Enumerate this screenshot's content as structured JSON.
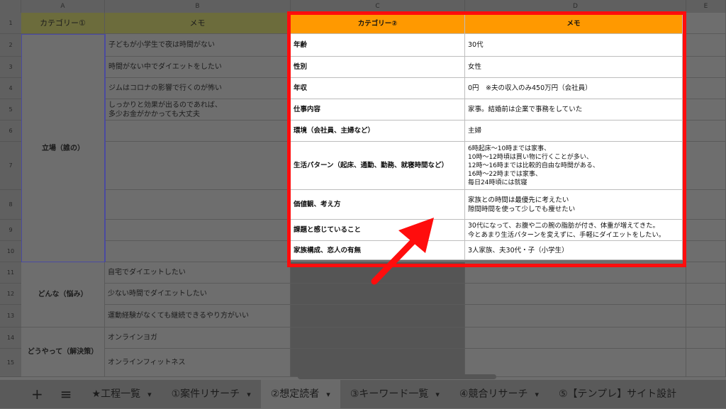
{
  "columns": [
    "A",
    "B",
    "C",
    "D",
    "E"
  ],
  "rows": [
    "1",
    "2",
    "3",
    "4",
    "5",
    "6",
    "7",
    "8",
    "9",
    "10",
    "11",
    "12",
    "13",
    "14",
    "15"
  ],
  "left_header": {
    "category1": "カテゴリー①",
    "memo": "メモ"
  },
  "groups": [
    "立場（誰の）",
    "どんな（悩み）",
    "どうやって（解決策）"
  ],
  "memo_b": [
    "子どもが小学生で夜は時間がない",
    "時間がない中でダイエットをしたい",
    "ジムはコロナの影響で行くのが怖い",
    "しっかりと効果が出るのであれば、\n多少お金がかかっても大丈夫",
    "",
    "",
    "",
    "",
    "",
    "自宅でダイエットしたい",
    "少ない時間でダイエットしたい",
    "運動経験がなくても継続できるやり方がいい",
    "オンラインヨガ",
    "オンラインフィットネス"
  ],
  "highlight": {
    "header_c": "カテゴリー②",
    "header_d": "メモ",
    "labels": [
      "年齢",
      "性別",
      "年収",
      "仕事内容",
      "環境（会社員、主婦など）",
      "生活パターン（起床、通勤、勤務、就寝時間など）",
      "価値観、考え方",
      "課題と感じていること",
      "家族構成、恋人の有無"
    ],
    "values": [
      "30代",
      "女性",
      "0円　※夫の収入のみ450万円（会社員）",
      "家事。結婚前は企業で事務をしていた",
      "主婦",
      "6時起床〜10時までは家事、\n10時〜12時頃は買い物に行くことが多い、\n12時〜16時までは比較的自由な時間がある、\n16時〜22時までは家事、\n毎日24時頃には就寝",
      "家族との時間は最優先に考えたい\n隙間時間を使って少しでも痩せたい",
      "30代になって、お腹や二の腕の脂肪が付き、体重が増えてきた。\n今とあまり生活パターンを変えずに、手軽にダイエットをしたい。",
      "3人家族、夫30代・子（小学生）"
    ]
  },
  "tabs": [
    "★工程一覧",
    "①案件リサーチ",
    "②想定読者",
    "③キーワード一覧",
    "④競合リサーチ",
    "⑤【テンプレ】サイト設計"
  ],
  "tab_arrow": "▾",
  "add_icon": "+",
  "menu_icon": "≡",
  "colors": {
    "highlight_header": "#ff9900",
    "red_frame": "#ff0d0d"
  }
}
